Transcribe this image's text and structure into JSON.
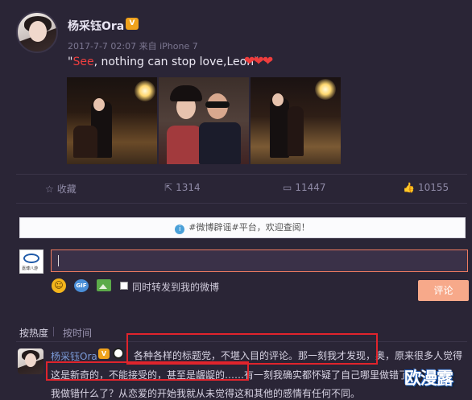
{
  "post": {
    "author": "杨采钰Ora",
    "vip_badge": "V",
    "meta": "2017-7-7 02:07 来自 iPhone 7",
    "content_quote_open": "\"",
    "content_red": "See",
    "content_rest": ", nothing can stop love,Leon\"",
    "hearts": "❤❤❤"
  },
  "actions": {
    "favorite": "收藏",
    "repost_count": "1314",
    "comment_count": "11447",
    "like_count": "10155"
  },
  "comment_box": {
    "notice": "#微博辟谣#平台，欢迎查阅！",
    "input_value": "",
    "also_repost_label": "同时转发到我的微博",
    "submit_label": "评论",
    "user_logo_caption": "嘉博八游"
  },
  "sort": {
    "by_hot": "按热度",
    "by_time": "按时间"
  },
  "comment": {
    "author": "杨采钰Ora",
    "line1": "各种各样的标题党，不堪入目的评论。那一刻我才发现，奥，原来很多人觉得",
    "line2": "这是新奇的，不能接受的，甚至是龌龊的……有一刻我确实都怀疑了自己哪里做错了",
    "line3": "我做错什么了？从恋爱的开始我就从未觉得这和其他的感情有任何不同。"
  },
  "watermark": "欧漫露",
  "colors": {
    "background": "#2a2536",
    "accent_red": "#ef3f3f",
    "link_blue": "#7b9ad8",
    "submit_bg": "#f7a98a",
    "highlight_box": "#e0242c"
  }
}
